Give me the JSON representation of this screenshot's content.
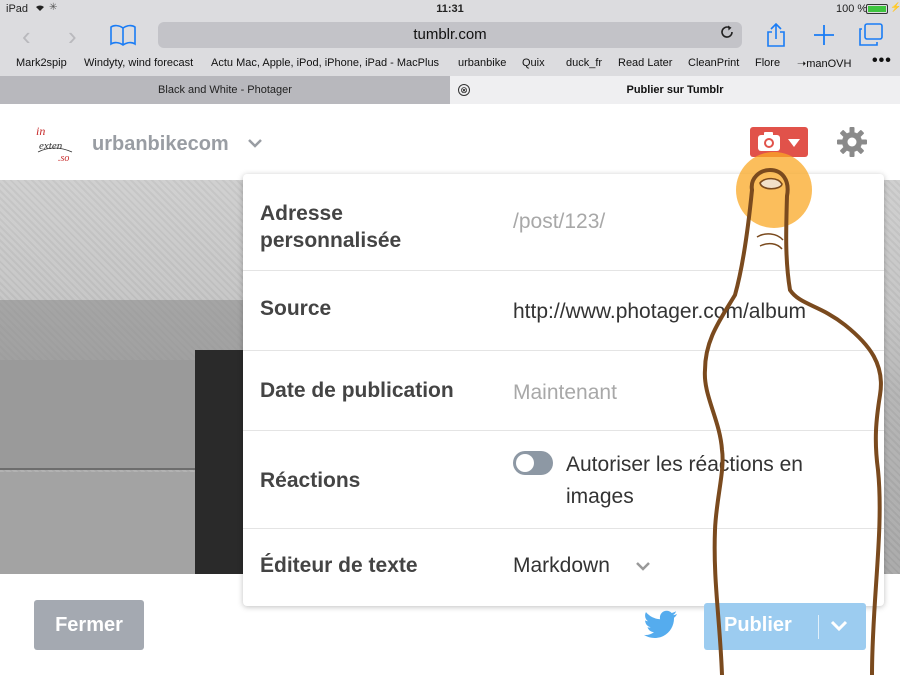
{
  "status": {
    "device": "iPad",
    "time": "11:31",
    "battery": "100 %"
  },
  "browser": {
    "url": "tumblr.com",
    "bookmarks": [
      "Mark2spip",
      "Windyty, wind forecast",
      "Actu Mac, Apple, iPod, iPhone, iPad - MacPlus",
      "urbanbike",
      "Quix",
      "duck_fr",
      "Read Later",
      "CleanPrint",
      "Flore",
      "➝manOVH"
    ],
    "more": "•••",
    "tabs": [
      {
        "title": "Black and White - Photager"
      },
      {
        "title": "Publier sur Tumblr",
        "close": "⊗"
      }
    ]
  },
  "header": {
    "blog_name": "urbanbikecom",
    "logo_text": [
      "in",
      "exten",
      ".so"
    ]
  },
  "panel": {
    "url_label": "Adresse personnalisée",
    "url_placeholder": "/post/123/",
    "source_label": "Source",
    "source_value": "http://www.photager.com/album",
    "date_label": "Date de publication",
    "date_placeholder": "Maintenant",
    "reactions_label": "Réactions",
    "reactions_text": "Autoriser les réactions en images",
    "reactions_enabled": false,
    "editor_label": "Éditeur de texte",
    "editor_value": "Markdown"
  },
  "buttons": {
    "close": "Fermer",
    "publish": "Publier"
  },
  "icons": [
    "back-icon",
    "forward-icon",
    "bookmarks-icon",
    "reload-icon",
    "share-icon",
    "add-icon",
    "tabs-icon",
    "camera-icon",
    "gear-icon",
    "twitter-icon",
    "chevron-down-icon"
  ],
  "colors": {
    "camera": "#e1524a",
    "publish": "#9cccf0",
    "close": "#a4a9b1",
    "twitter": "#55acee",
    "touch": "#f9a825"
  }
}
